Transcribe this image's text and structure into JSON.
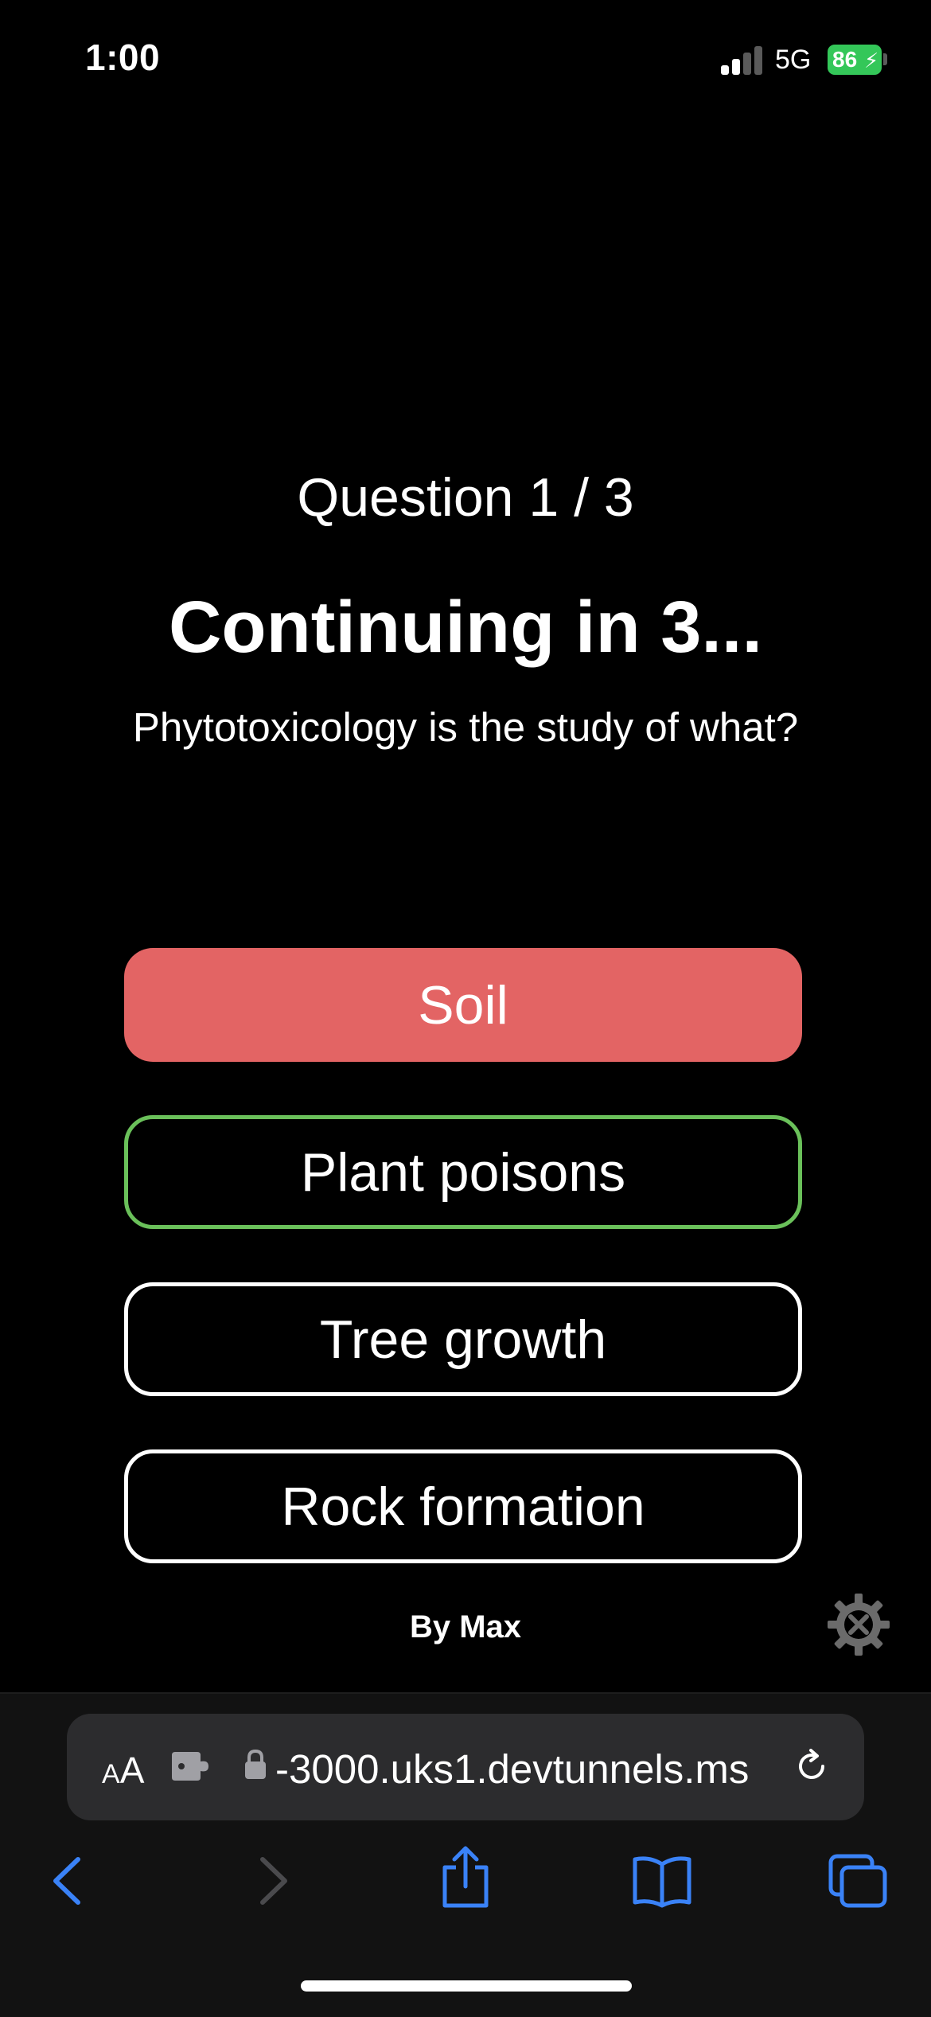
{
  "status_bar": {
    "time": "1:00",
    "network": "5G",
    "battery": "86",
    "charging": true
  },
  "quiz": {
    "question_counter": "Question 1 / 3",
    "countdown": "Continuing in 3...",
    "question": "Phytotoxicology is the study of what?",
    "answers": [
      {
        "label": "Soil",
        "state": "wrong"
      },
      {
        "label": "Plant poisons",
        "state": "correct"
      },
      {
        "label": "Tree growth",
        "state": "neutral"
      },
      {
        "label": "Rock formation",
        "state": "neutral"
      }
    ],
    "credit": "By Max"
  },
  "browser": {
    "aa_small": "A",
    "aa_large": "A",
    "url": "-3000.uks1.devtunnels.ms",
    "icons": [
      "extension-icon",
      "lock-icon",
      "reload-icon",
      "back-icon",
      "forward-icon",
      "share-icon",
      "bookmarks-icon",
      "tabs-icon"
    ]
  },
  "colors": {
    "background": "#000000",
    "wrong": "#e36464",
    "correct": "#6ac05a",
    "accent": "#3a82f7",
    "battery": "#34c759"
  }
}
